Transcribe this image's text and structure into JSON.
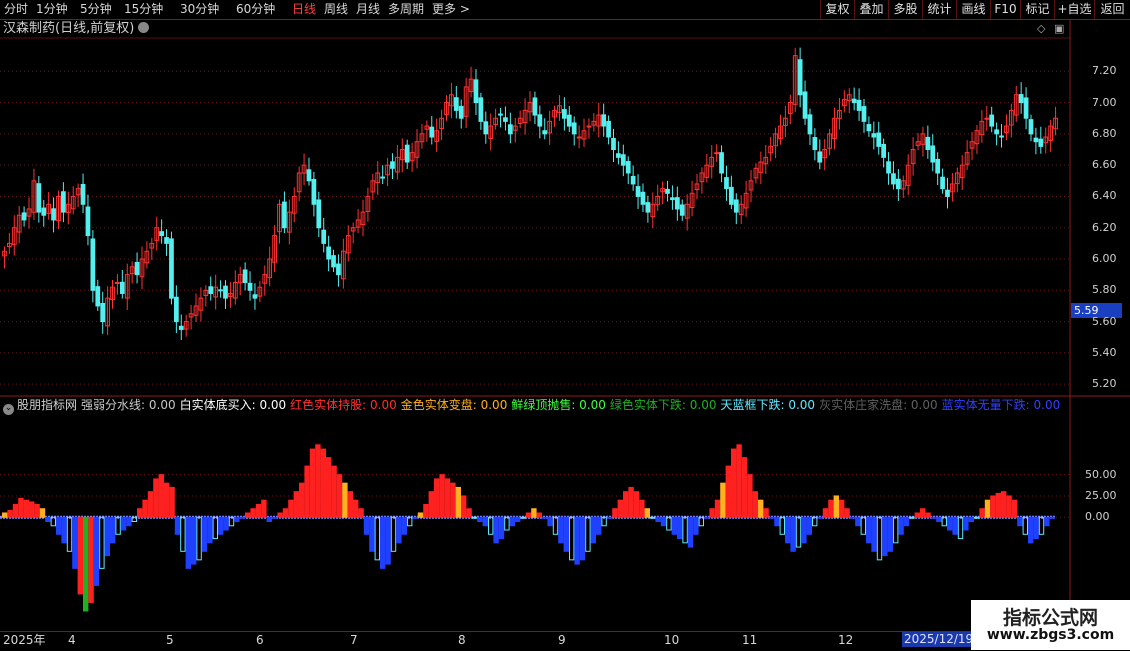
{
  "topbar": {
    "periods": [
      "分时",
      "1分钟",
      "5分钟",
      "15分钟",
      "30分钟",
      "60分钟",
      "日线",
      "周线",
      "月线",
      "多周期",
      "更多 >"
    ],
    "active_period": "日线",
    "right_buttons": [
      "复权",
      "叠加",
      "多股",
      "统计",
      "画线",
      "F10",
      "标记",
      "+自选",
      "返回"
    ]
  },
  "chart_title": "汉森制药(日线,前复权)",
  "price_axis": [
    "7.20",
    "7.00",
    "6.80",
    "6.60",
    "6.40",
    "6.20",
    "6.00",
    "5.80",
    "5.60",
    "5.40",
    "5.20"
  ],
  "current_price": "5.59",
  "indicator_axis": [
    "50.00",
    "25.00",
    "0.00"
  ],
  "indicator": {
    "name": "股朋指标网",
    "items": [
      {
        "label": "强弱分水线: 0.00",
        "color": "#c8c8c8"
      },
      {
        "label": "白实体底买入: 0.00",
        "color": "#ffffff"
      },
      {
        "label": "红色实体持股: 0.00",
        "color": "#ff3030"
      },
      {
        "label": "金色实体变盘: 0.00",
        "color": "#ffb020"
      },
      {
        "label": "鲜绿顶抛售: 0.00",
        "color": "#40ff40"
      },
      {
        "label": "绿色实体下跌: 0.00",
        "color": "#20b020"
      },
      {
        "label": "天蓝框下跌: 0.00",
        "color": "#60e8ff"
      },
      {
        "label": "灰实体庄家洗盘: 0.00",
        "color": "#606060"
      },
      {
        "label": "蓝实体无量下跌: 0.00",
        "color": "#3040ff"
      }
    ]
  },
  "date_labels": [
    "2025年",
    "4",
    "5",
    "6",
    "7",
    "8",
    "9",
    "10",
    "11",
    "12"
  ],
  "current_date": "2025/12/19/五",
  "watermark": {
    "line1": "指标公式网",
    "line2": "www.zbgs3.com"
  },
  "chart_data": {
    "type": "candlestick",
    "ylim": [
      5.15,
      7.4
    ],
    "closes": [
      6.05,
      6.1,
      6.2,
      6.28,
      6.25,
      6.32,
      6.5,
      6.3,
      6.28,
      6.35,
      6.25,
      6.4,
      6.3,
      6.35,
      6.4,
      6.45,
      6.35,
      6.15,
      5.8,
      5.7,
      5.6,
      5.75,
      5.82,
      5.85,
      5.78,
      5.9,
      5.95,
      5.9,
      6.0,
      6.05,
      6.1,
      6.2,
      6.15,
      6.1,
      5.75,
      5.6,
      5.55,
      5.6,
      5.65,
      5.7,
      5.75,
      5.8,
      5.78,
      5.82,
      5.8,
      5.75,
      5.78,
      5.85,
      5.9,
      5.85,
      5.8,
      5.75,
      5.82,
      5.9,
      6.0,
      6.15,
      6.35,
      6.2,
      6.3,
      6.4,
      6.55,
      6.6,
      6.5,
      6.35,
      6.2,
      6.1,
      6.0,
      5.95,
      5.9,
      6.05,
      6.15,
      6.2,
      6.25,
      6.3,
      6.4,
      6.5,
      6.55,
      6.52,
      6.6,
      6.58,
      6.65,
      6.7,
      6.62,
      6.68,
      6.75,
      6.8,
      6.85,
      6.78,
      6.82,
      6.9,
      7.0,
      7.05,
      6.95,
      6.9,
      7.1,
      7.15,
      7.0,
      6.88,
      6.8,
      6.85,
      6.9,
      6.92,
      6.88,
      6.8,
      6.85,
      6.9,
      6.95,
      7.0,
      6.92,
      6.85,
      6.8,
      6.88,
      6.95,
      6.98,
      6.9,
      6.85,
      6.8,
      6.78,
      6.82,
      6.85,
      6.88,
      6.92,
      6.85,
      6.78,
      6.7,
      6.65,
      6.6,
      6.55,
      6.48,
      6.4,
      6.35,
      6.3,
      6.35,
      6.4,
      6.45,
      6.42,
      6.38,
      6.32,
      6.28,
      6.35,
      6.42,
      6.48,
      6.55,
      6.6,
      6.65,
      6.68,
      6.55,
      6.45,
      6.35,
      6.3,
      6.35,
      6.42,
      6.5,
      6.58,
      6.62,
      6.65,
      6.72,
      6.8,
      6.85,
      6.9,
      7.0,
      7.3,
      7.05,
      6.9,
      6.8,
      6.7,
      6.62,
      6.7,
      6.8,
      6.9,
      6.95,
      7.02,
      7.05,
      7.0,
      6.95,
      6.88,
      6.82,
      6.78,
      6.72,
      6.65,
      6.55,
      6.48,
      6.45,
      6.5,
      6.6,
      6.7,
      6.75,
      6.8,
      6.7,
      6.62,
      6.55,
      6.45,
      6.4,
      6.48,
      6.55,
      6.6,
      6.68,
      6.75,
      6.82,
      6.88,
      6.9,
      6.85,
      6.8,
      6.78,
      6.85,
      6.95,
      7.05,
      7.0,
      6.9,
      6.8,
      6.75,
      6.72,
      6.78,
      6.85,
      6.9
    ],
    "indicator_values": [
      5,
      8,
      15,
      22,
      20,
      18,
      15,
      10,
      -5,
      -10,
      -20,
      -30,
      -40,
      -60,
      -90,
      -110,
      -100,
      -80,
      -60,
      -45,
      -30,
      -20,
      -15,
      -10,
      -5,
      10,
      20,
      30,
      45,
      50,
      40,
      35,
      -20,
      -40,
      -60,
      -55,
      -50,
      -40,
      -30,
      -25,
      -20,
      -15,
      -10,
      -5,
      0,
      5,
      10,
      15,
      20,
      -5,
      0,
      5,
      10,
      20,
      30,
      40,
      60,
      80,
      85,
      80,
      70,
      60,
      50,
      40,
      30,
      20,
      10,
      -20,
      -40,
      -50,
      -60,
      -55,
      -40,
      -30,
      -20,
      -10,
      0,
      5,
      15,
      30,
      45,
      50,
      45,
      40,
      35,
      25,
      10,
      0,
      -5,
      -10,
      -20,
      -30,
      -25,
      -15,
      -10,
      -5,
      0,
      5,
      10,
      5,
      0,
      -10,
      -20,
      -30,
      -40,
      -50,
      -55,
      -50,
      -40,
      -30,
      -20,
      -10,
      0,
      10,
      20,
      30,
      35,
      30,
      20,
      10,
      0,
      -5,
      -10,
      -15,
      -20,
      -25,
      -30,
      -35,
      -20,
      -10,
      0,
      10,
      20,
      40,
      60,
      80,
      85,
      70,
      50,
      30,
      20,
      10,
      0,
      -10,
      -20,
      -30,
      -40,
      -35,
      -30,
      -20,
      -10,
      0,
      10,
      20,
      25,
      20,
      10,
      0,
      -10,
      -20,
      -30,
      -40,
      -50,
      -45,
      -40,
      -30,
      -20,
      -10,
      0,
      5,
      10,
      5,
      0,
      -5,
      -10,
      -15,
      -20,
      -25,
      -15,
      -5,
      0,
      10,
      20,
      25,
      28,
      30,
      25,
      20,
      -10,
      -20,
      -30,
      -25,
      -20,
      -10,
      0
    ]
  }
}
